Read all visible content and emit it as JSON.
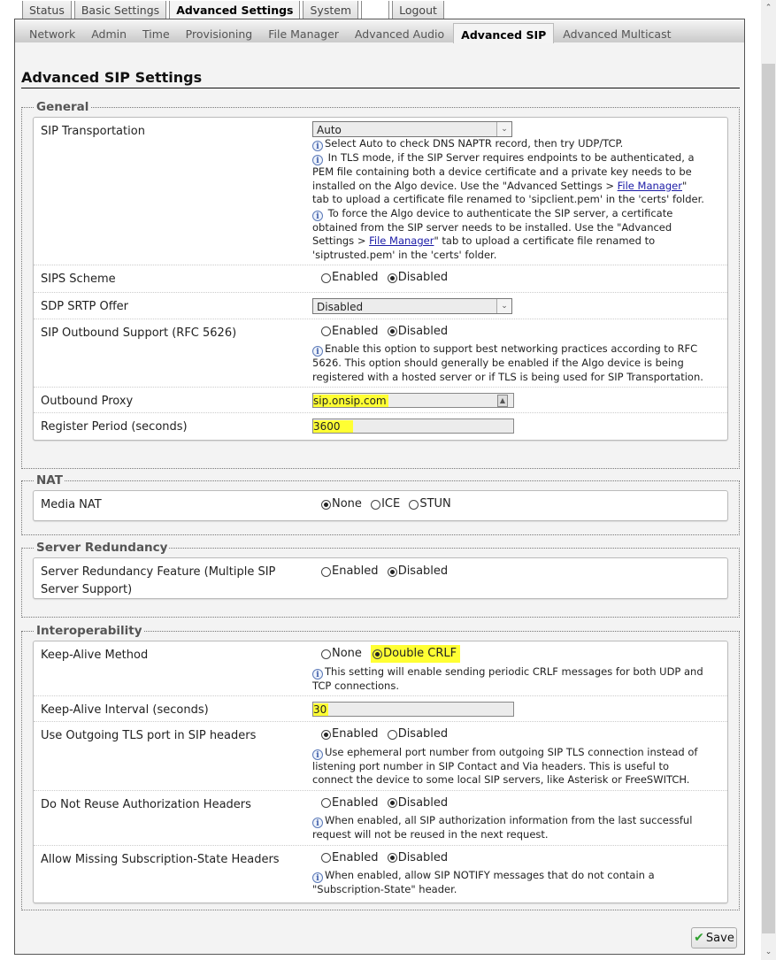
{
  "top_tabs": [
    {
      "label": "Status",
      "active": false
    },
    {
      "label": "Basic Settings",
      "active": false
    },
    {
      "label": "Advanced Settings",
      "active": true
    },
    {
      "label": "System",
      "active": false
    },
    {
      "label": "",
      "active": false
    },
    {
      "label": "Logout",
      "active": false
    }
  ],
  "sub_tabs": [
    {
      "label": "Network"
    },
    {
      "label": "Admin"
    },
    {
      "label": "Time"
    },
    {
      "label": "Provisioning"
    },
    {
      "label": "File Manager"
    },
    {
      "label": "Advanced Audio"
    },
    {
      "label": "Advanced SIP",
      "active": true
    },
    {
      "label": "Advanced Multicast"
    }
  ],
  "page_title": "Advanced SIP Settings",
  "general": {
    "legend": "General",
    "sip_transport": {
      "label": "SIP Transportation",
      "value": "Auto",
      "help1": "Select Auto to check DNS NAPTR record, then try UDP/TCP.",
      "help2_a": " In TLS mode, if the SIP Server requires endpoints to be authenticated, a PEM file containing both a device certificate and a private key needs to be installed on the Algo device. Use the \"Advanced Settings > ",
      "help2_link": "File Manager",
      "help2_b": "\" tab to upload a certificate file renamed to 'sipclient.pem' in the 'certs' folder.",
      "help3_a": " To force the Algo device to authenticate the SIP server, a certificate obtained from the SIP server needs to be installed. Use the \"Advanced Settings > ",
      "help3_link": "File Manager",
      "help3_b": "\" tab to upload a certificate file renamed to 'siptrusted.pem' in the 'certs' folder."
    },
    "sips_scheme": {
      "label": "SIPS Scheme",
      "opt1": "Enabled",
      "opt2": "Disabled",
      "selected": "Disabled"
    },
    "sdp_srtp": {
      "label": "SDP SRTP Offer",
      "value": "Disabled"
    },
    "sip_outbound": {
      "label": "SIP Outbound Support (RFC 5626)",
      "opt1": "Enabled",
      "opt2": "Disabled",
      "selected": "Disabled",
      "help": "Enable this option to support best networking practices according to RFC 5626. This option should generally be enabled if the Algo device is being registered with a hosted server or if TLS is being used for SIP Transportation."
    },
    "outbound_proxy": {
      "label": "Outbound Proxy",
      "value": "sip.onsip.com"
    },
    "register_period": {
      "label": "Register Period (seconds)",
      "value": "3600"
    }
  },
  "nat": {
    "legend": "NAT",
    "media_nat": {
      "label": "Media NAT",
      "opt1": "None",
      "opt2": "ICE",
      "opt3": "STUN",
      "selected": "None"
    }
  },
  "redundancy": {
    "legend": "Server Redundancy",
    "feature": {
      "label": "Server Redundancy Feature (Multiple SIP Server Support)",
      "opt1": "Enabled",
      "opt2": "Disabled",
      "selected": "Disabled"
    }
  },
  "interop": {
    "legend": "Interoperability",
    "keepalive_method": {
      "label": "Keep-Alive Method",
      "opt1": "None",
      "opt2": "Double CRLF",
      "selected": "Double CRLF",
      "help": "This setting will enable sending periodic CRLF messages for both UDP and TCP connections."
    },
    "keepalive_interval": {
      "label": "Keep-Alive Interval (seconds)",
      "value": "30"
    },
    "outgoing_tls": {
      "label": "Use Outgoing TLS port in SIP headers",
      "opt1": "Enabled",
      "opt2": "Disabled",
      "selected": "Enabled",
      "help": "Use ephemeral port number from outgoing SIP TLS connection instead of listening port number in SIP Contact and Via headers. This is useful to connect the device to some local SIP servers, like Asterisk or FreeSWITCH."
    },
    "no_reuse_auth": {
      "label": "Do Not Reuse Authorization Headers",
      "opt1": "Enabled",
      "opt2": "Disabled",
      "selected": "Disabled",
      "help": "When enabled, all SIP authorization information from the last successful request will not be reused in the next request."
    },
    "missing_sub_state": {
      "label": "Allow Missing Subscription-State Headers",
      "opt1": "Enabled",
      "opt2": "Disabled",
      "selected": "Disabled",
      "help": "When enabled, allow SIP NOTIFY messages that do not contain a \"Subscription-State\" header."
    }
  },
  "save_label": "Save",
  "highlight_color": "#ffff33"
}
